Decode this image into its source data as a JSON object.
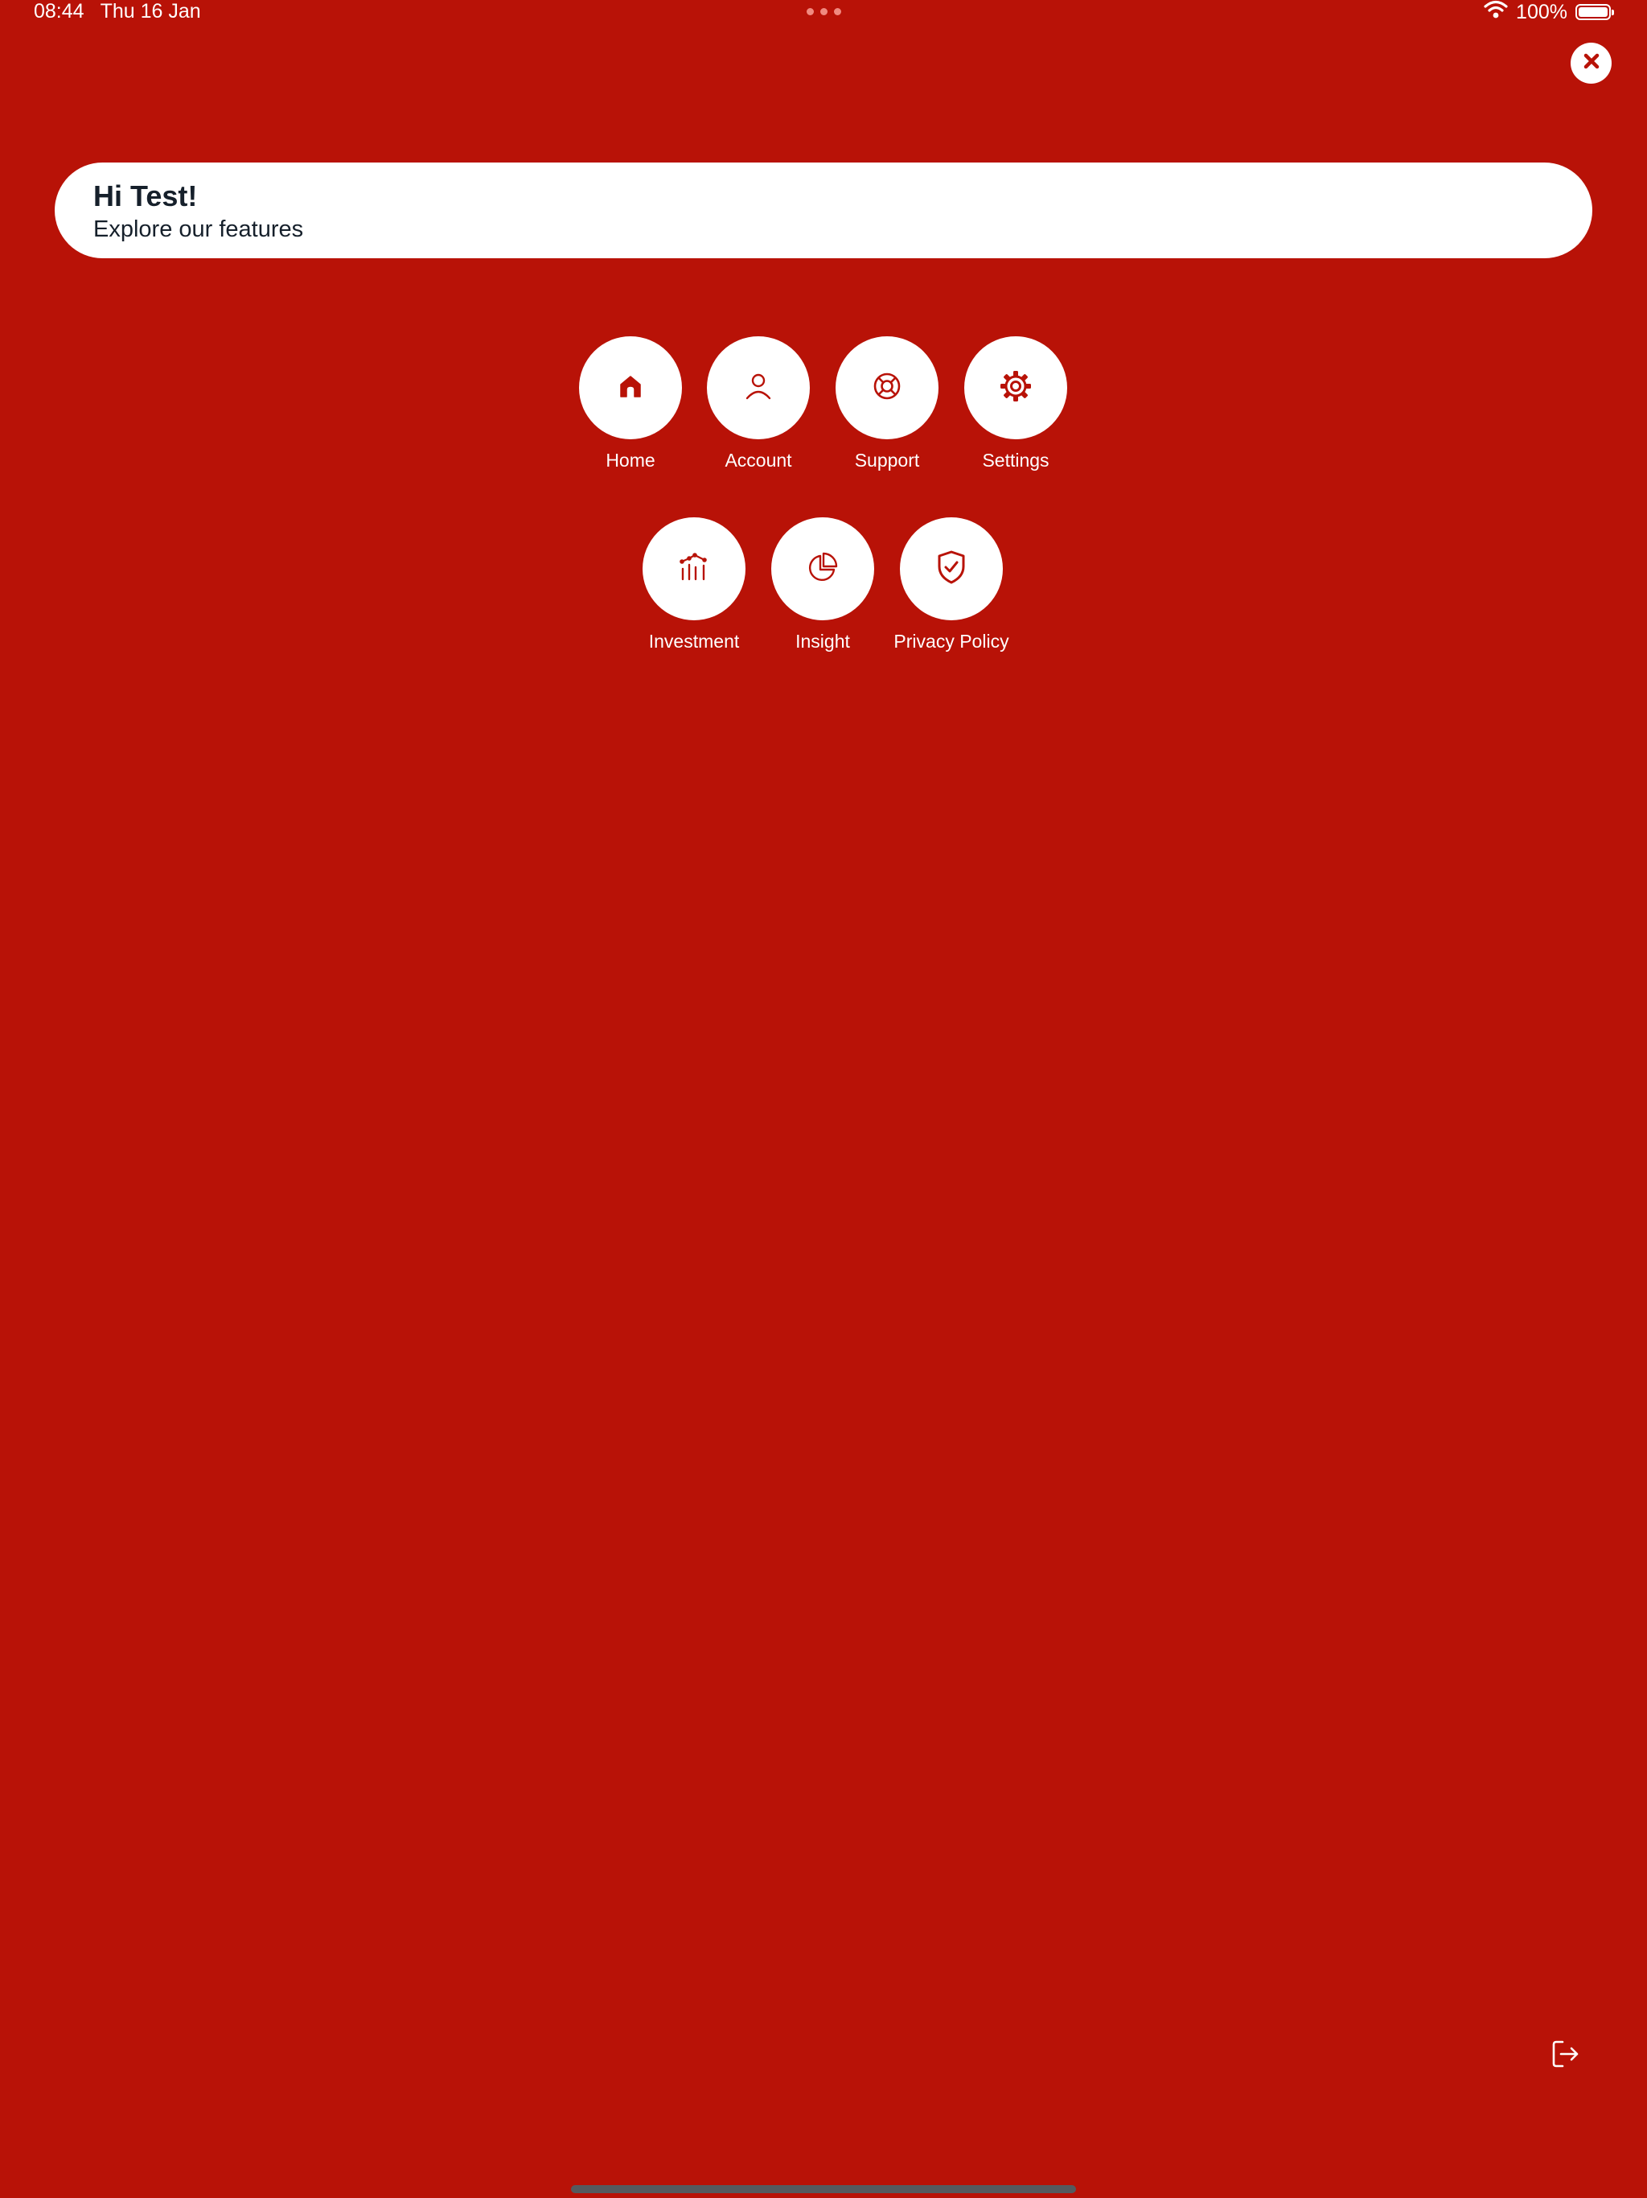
{
  "status_bar": {
    "time": "08:44",
    "date": "Thu 16 Jan",
    "battery_text": "100%",
    "battery_level_percent": 100,
    "wifi_icon": "wifi-icon",
    "battery_icon": "battery-icon"
  },
  "close_button": {
    "icon": "close-icon"
  },
  "greeting": {
    "title": "Hi Test!",
    "subtitle": "Explore our features"
  },
  "features": [
    {
      "label": "Home",
      "icon": "home-icon"
    },
    {
      "label": "Account",
      "icon": "user-icon"
    },
    {
      "label": "Support",
      "icon": "lifebuoy-icon"
    },
    {
      "label": "Settings",
      "icon": "gear-icon"
    },
    {
      "label": "Investment",
      "icon": "investment-chart-icon"
    },
    {
      "label": "Insight",
      "icon": "pie-chart-icon"
    },
    {
      "label": "Privacy Policy",
      "icon": "shield-check-icon"
    }
  ],
  "logout_button": {
    "icon": "logout-icon"
  },
  "colors": {
    "background": "#b81207",
    "card": "#ffffff",
    "accent_icon": "#b81207",
    "text_dark": "#16202b"
  }
}
